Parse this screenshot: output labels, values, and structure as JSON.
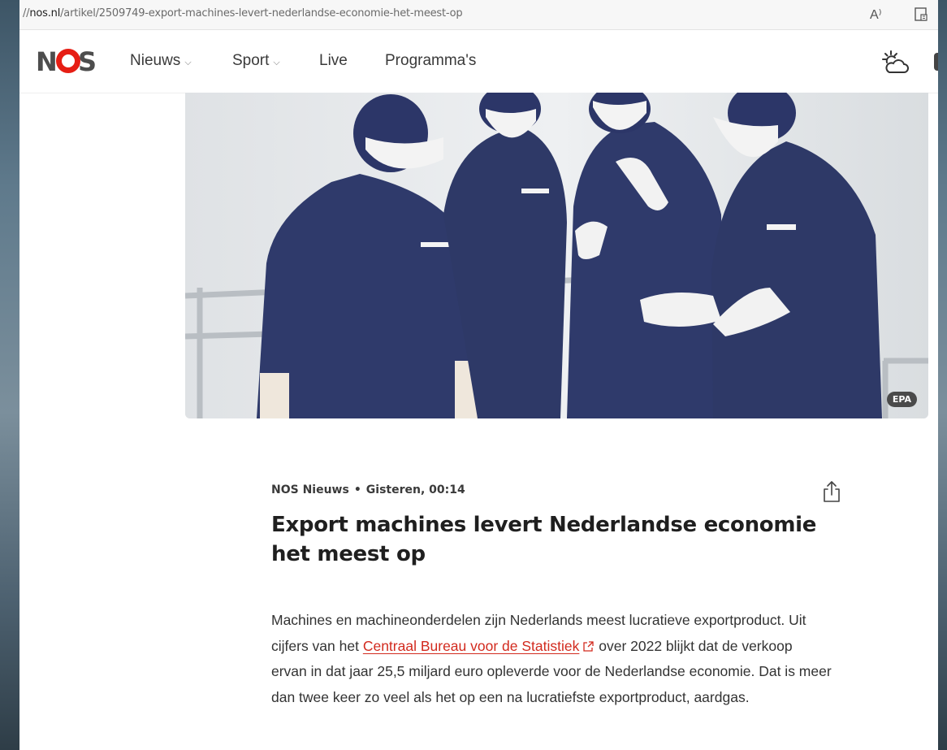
{
  "browser": {
    "url_prefix": "//",
    "url_host": "nos.nl",
    "url_path": "/artikel/2509749-export-machines-levert-nederlandse-economie-het-meest-op",
    "read_aloud_label": "A⁾",
    "icons": [
      "read-aloud-icon",
      "immersive-reader-icon"
    ]
  },
  "site": {
    "logo": "NOS",
    "brand_color": "#e61e14",
    "nav": [
      {
        "label": "Nieuws",
        "dropdown": true
      },
      {
        "label": "Sport",
        "dropdown": true
      },
      {
        "label": "Live",
        "dropdown": false
      },
      {
        "label": "Programma's",
        "dropdown": false
      }
    ],
    "weather_icon": "sun-cloud-icon"
  },
  "hero": {
    "credit": "EPA"
  },
  "article": {
    "source": "NOS Nieuws",
    "separator": "•",
    "time": "Gisteren, 00:14",
    "title": "Export machines levert Nederlandse economie het meest op",
    "p1_before": "Machines en machineonderdelen zijn Nederlands meest lucratieve exportproduct. Uit cijfers van het ",
    "p1_link": "Centraal Bureau voor de Statistiek",
    "p1_after": " over 2022 blijkt dat de verkoop ervan in dat jaar 25,5 miljard euro opleverde voor de Nederlandse economie. Dat is meer dan twee keer zo veel als het op een na lucratiefste exportproduct, aardgas.",
    "link_color": "#d22a1e"
  }
}
